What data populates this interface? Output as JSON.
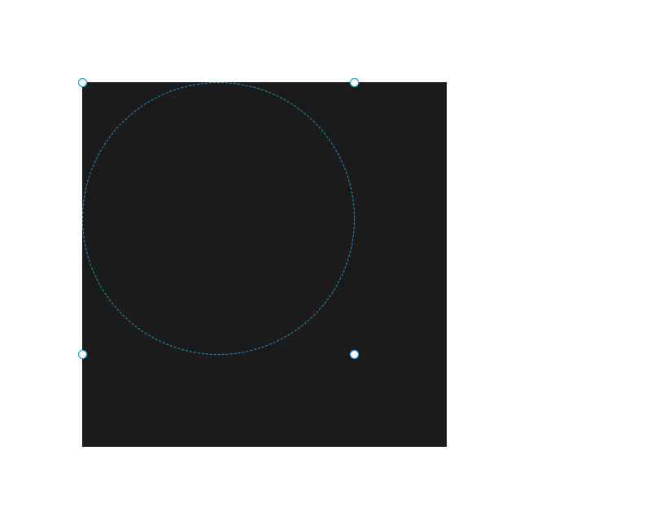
{
  "canvas": {
    "fill_color": "#1b1b1b"
  },
  "selection": {
    "shape": "circle",
    "outline_color": "#1aa9e3",
    "outline_style": "dashed",
    "handles": [
      "top-left",
      "top-right",
      "bottom-left",
      "bottom-right"
    ],
    "handle_fill": "#ffffff",
    "handle_stroke": "#1aa9e3"
  }
}
